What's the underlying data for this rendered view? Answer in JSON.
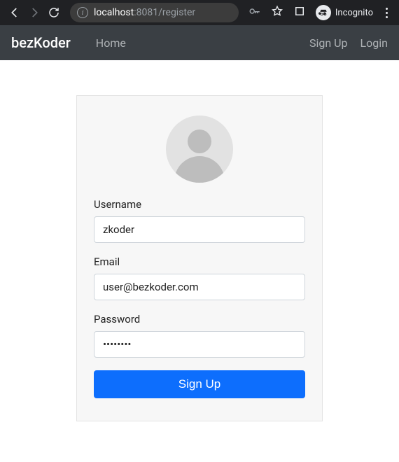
{
  "browser": {
    "url_host": "localhost",
    "url_port": ":8081",
    "url_path": "/register",
    "incognito_label": "Incognito"
  },
  "navbar": {
    "brand": "bezKoder",
    "home": "Home",
    "signup": "Sign Up",
    "login": "Login"
  },
  "form": {
    "username_label": "Username",
    "username_value": "zkoder",
    "email_label": "Email",
    "email_value": "user@bezkoder.com",
    "password_label": "Password",
    "password_value": "bezkoder",
    "submit_label": "Sign Up"
  }
}
